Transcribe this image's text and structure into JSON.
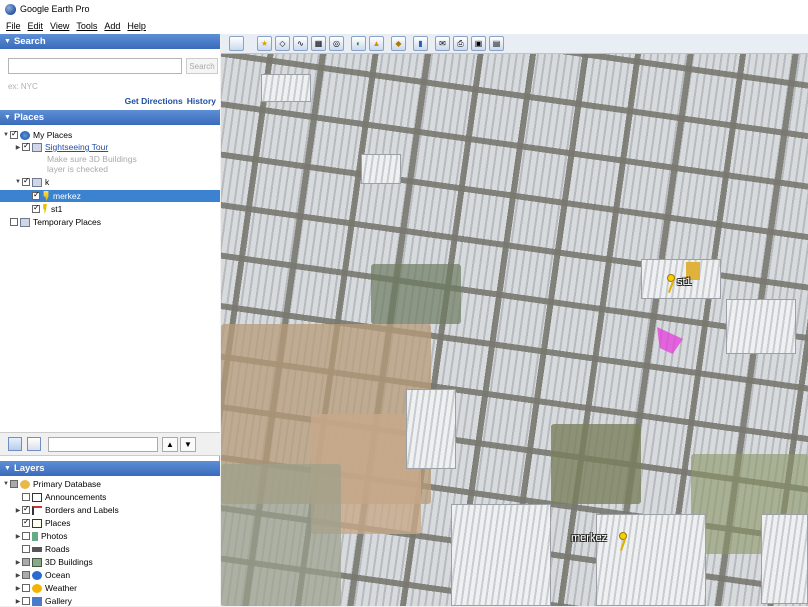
{
  "window": {
    "title": "Google Earth Pro"
  },
  "menu": [
    "File",
    "Edit",
    "View",
    "Tools",
    "Add",
    "Help"
  ],
  "search": {
    "header": "Search",
    "input_value": "",
    "button_label": "Search",
    "hint": "ex: NYC",
    "links": {
      "directions": "Get Directions",
      "history": "History"
    }
  },
  "places": {
    "header": "Places",
    "my_places": "My Places",
    "sightseeing": "Sightseeing Tour",
    "sightseeing_note_1": "Make sure 3D Buildings",
    "sightseeing_note_2": "layer is checked",
    "folder_k": "k",
    "merkez": "merkez",
    "st1": "st1",
    "temporary": "Temporary Places"
  },
  "mini_toolbar": {
    "input_value": ""
  },
  "layers": {
    "header": "Layers",
    "items": [
      "Primary Database",
      "Announcements",
      "Borders and Labels",
      "Places",
      "Photos",
      "Roads",
      "3D Buildings",
      "Ocean",
      "Weather",
      "Gallery"
    ]
  },
  "map": {
    "labels": {
      "st1": "st1",
      "merkez": "merkez"
    }
  },
  "colors": {
    "header_blue": "#3a6bbb",
    "selection": "#3b83d0",
    "pin_yellow": "#f4d000"
  }
}
